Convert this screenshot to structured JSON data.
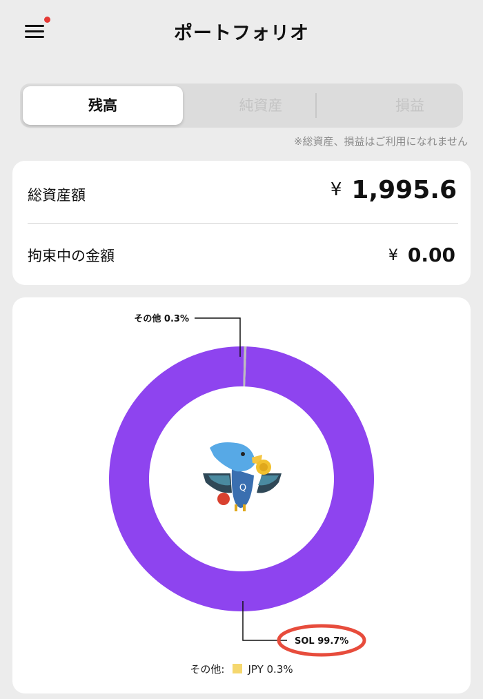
{
  "header": {
    "title": "ポートフォリオ",
    "menu_icon": "hamburger-menu-icon",
    "notification_color": "#e53935"
  },
  "tabs": [
    {
      "label": "残高",
      "active": true
    },
    {
      "label": "純資産",
      "active": false
    },
    {
      "label": "損益",
      "active": false
    }
  ],
  "tabs_notice": "※総資産、損益はご利用になれません",
  "summary": {
    "total": {
      "label": "総資産額",
      "currency": "¥",
      "value": "1,995.6"
    },
    "locked": {
      "label": "拘束中の金額",
      "currency": "¥",
      "value": "0.00"
    }
  },
  "chart_data": {
    "type": "pie",
    "donut": true,
    "center_icon": "bird-mascot-icon",
    "slices": [
      {
        "label": "SOL",
        "value": 99.7,
        "display": "SOL 99.7%",
        "color": "#8e44ef"
      },
      {
        "label": "その他",
        "value": 0.3,
        "display": "その他 0.3%",
        "color": "#bdbdbd"
      }
    ],
    "legend": {
      "prefix": "その他:",
      "items": [
        {
          "label": "JPY 0.3%",
          "color": "#f5d76e"
        }
      ]
    }
  },
  "annotation": {
    "shape": "ellipse",
    "target": "SOL 99.7%",
    "color": "#e74c3c"
  }
}
